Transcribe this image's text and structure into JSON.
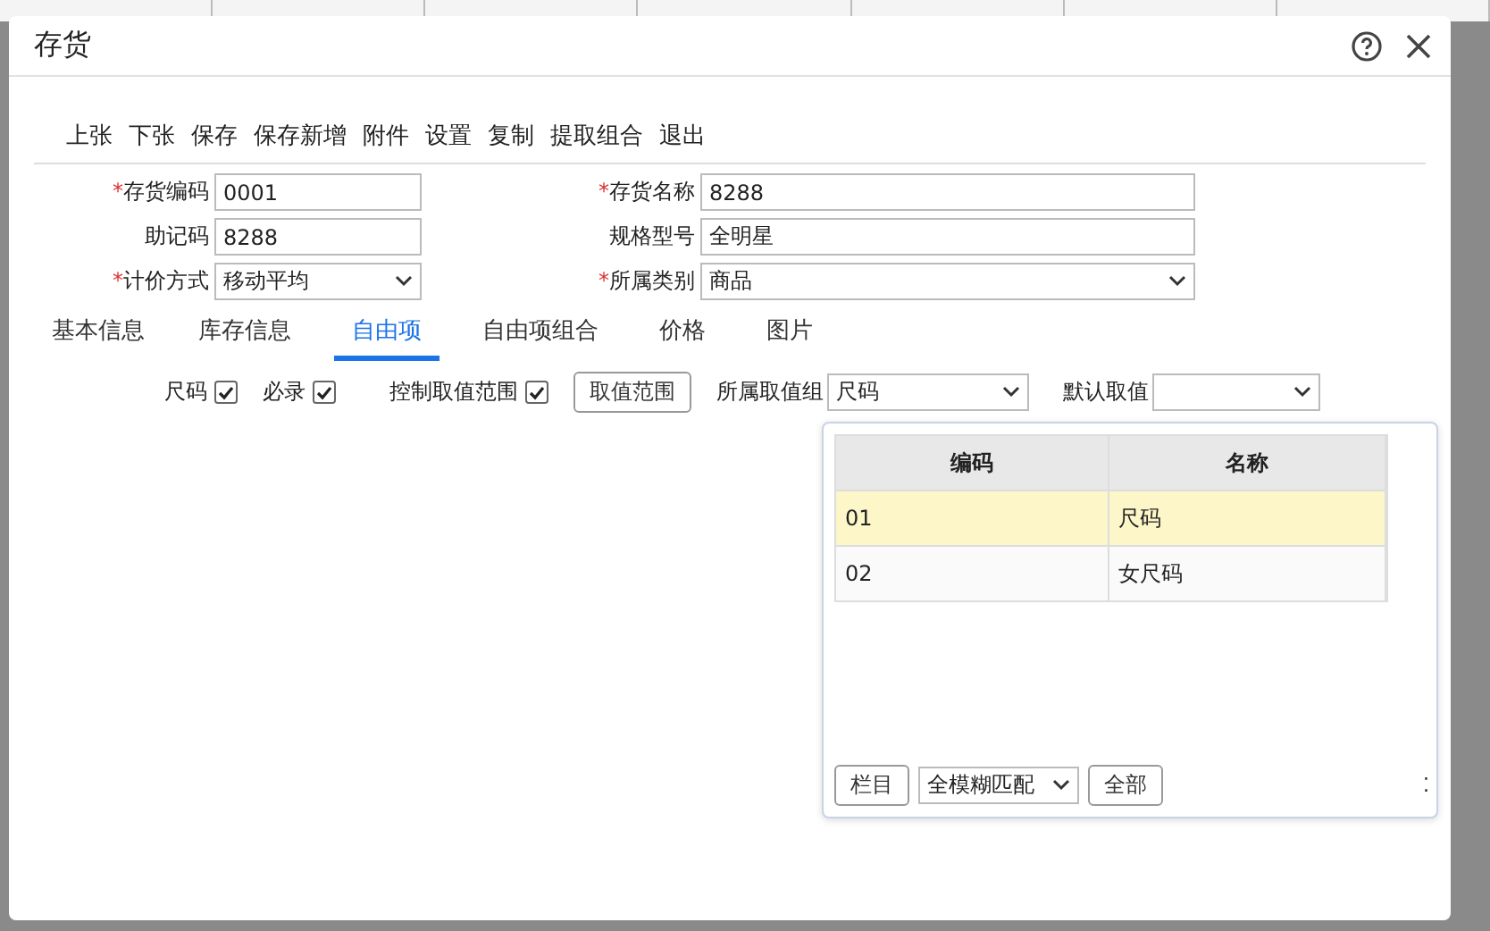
{
  "window": {
    "title": "存货"
  },
  "required_mark": "*",
  "toolbar": [
    "上张",
    "下张",
    "保存",
    "保存新增",
    "附件",
    "设置",
    "复制",
    "提取组合",
    "退出"
  ],
  "form": [
    {
      "label": "存货编码",
      "required": true,
      "value": "0001",
      "kind": "text"
    },
    {
      "label": "存货名称",
      "required": true,
      "value": "8288",
      "kind": "text"
    },
    {
      "label": "助记码",
      "required": false,
      "value": "8288",
      "kind": "text"
    },
    {
      "label": "规格型号",
      "required": false,
      "value": "全明星",
      "kind": "text"
    },
    {
      "label": "计价方式",
      "required": true,
      "value": "移动平均",
      "kind": "select"
    },
    {
      "label": "所属类别",
      "required": true,
      "value": "商品",
      "kind": "select"
    }
  ],
  "tabs": [
    {
      "label": "基本信息",
      "selected": false
    },
    {
      "label": "库存信息",
      "selected": false
    },
    {
      "label": "自由项",
      "selected": true
    },
    {
      "label": "自由项组合",
      "selected": false
    },
    {
      "label": "价格",
      "selected": false
    },
    {
      "label": "图片",
      "selected": false
    }
  ],
  "options": [
    {
      "label": "尺码",
      "checked": true
    },
    {
      "label": "必录",
      "checked": true
    },
    {
      "label": "控制取值范围",
      "checked": true
    }
  ],
  "range_button": "取值范围",
  "group_field": {
    "label": "所属取值组",
    "value": "尺码"
  },
  "default_field": {
    "label": "默认取值"
  },
  "popup": {
    "columns": [
      "编码",
      "名称"
    ],
    "rows": [
      {
        "cells": [
          "01",
          "尺码"
        ],
        "selected": true
      },
      {
        "cells": [
          "02",
          "女尺码"
        ],
        "selected": false
      }
    ],
    "columns_button": "栏目",
    "match_mode": "全模糊匹配",
    "all_button": "全部",
    "resize_grip": "⁚"
  }
}
